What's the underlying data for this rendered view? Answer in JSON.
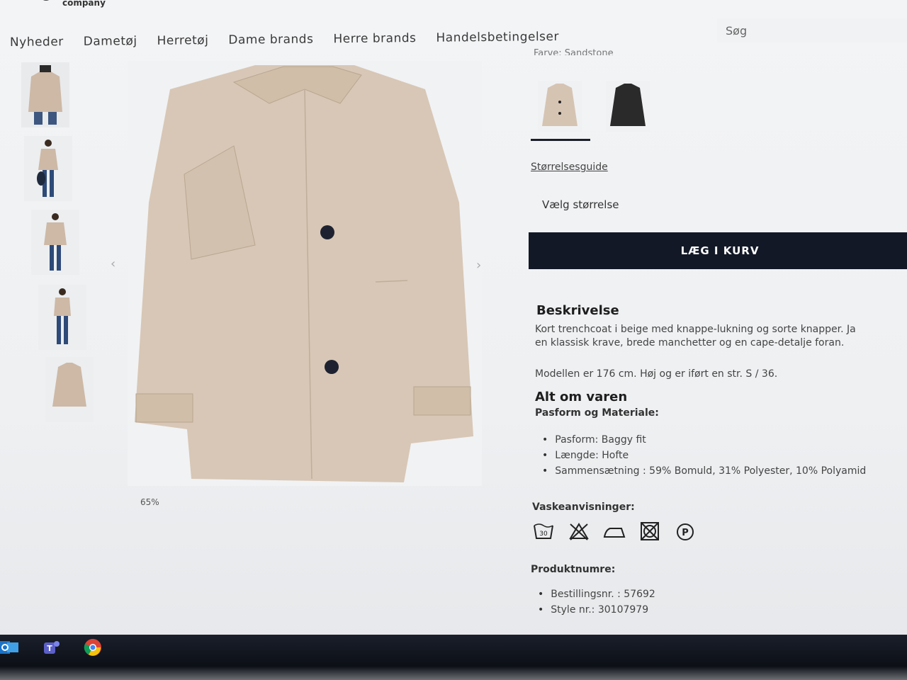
{
  "brand": {
    "name": "LK company"
  },
  "nav": {
    "items": [
      "Nyheder",
      "Dametøj",
      "Herretøj",
      "Dame brands",
      "Herre brands",
      "Handelsbetingelser"
    ]
  },
  "search": {
    "placeholder": "Søg"
  },
  "gallery": {
    "zoom_label": "65%",
    "thumbnails": [
      "front-model",
      "full-model-1",
      "full-model-2",
      "back-model",
      "product-only"
    ],
    "prev_icon": "chevron-left-icon",
    "next_icon": "chevron-right-icon"
  },
  "product": {
    "color_label": "Farve: Sandstone",
    "swatches": [
      {
        "name": "beige",
        "color": "#d6c4b3",
        "selected": true
      },
      {
        "name": "black",
        "color": "#2a2a2a",
        "selected": false
      }
    ],
    "size_guide": "Størrelsesguide",
    "size_select": "Vælg størrelse",
    "add_to_cart": "LÆG I KURV",
    "description_title": "Beskrivelse",
    "description_line1": "Kort trenchcoat i beige med knappe-lukning og sorte knapper. Ja",
    "description_line2": "en klassisk krave, brede manchetter og en cape-detalje foran.",
    "model_text": "Modellen er 176 cm. Høj og er iført en str. S / 36.",
    "about_title": "Alt om varen",
    "fit_title": "Pasform og Materiale:",
    "fit_items": [
      "Pasform: Baggy fit",
      "Længde: Hofte",
      "Sammensætning : 59% Bomuld, 31% Polyester, 10% Polyamid"
    ],
    "wash_title": "Vaskeanvisninger:",
    "wash_icons": [
      "wash-30-icon",
      "no-bleach-icon",
      "iron-icon",
      "no-tumble-dry-icon",
      "dry-clean-p-icon"
    ],
    "wash_30_text": "30",
    "dry_clean_text": "P",
    "product_numbers_title": "Produktnumre:",
    "product_numbers": [
      "Bestillingsnr. : 57692",
      "Style nr.: 30107979"
    ]
  },
  "taskbar": {
    "icons": [
      "outlook-icon",
      "teams-icon",
      "chrome-icon"
    ]
  },
  "colors": {
    "accent_dark": "#121826",
    "coat": "#d8c7b6",
    "background": "#eef0f2"
  }
}
